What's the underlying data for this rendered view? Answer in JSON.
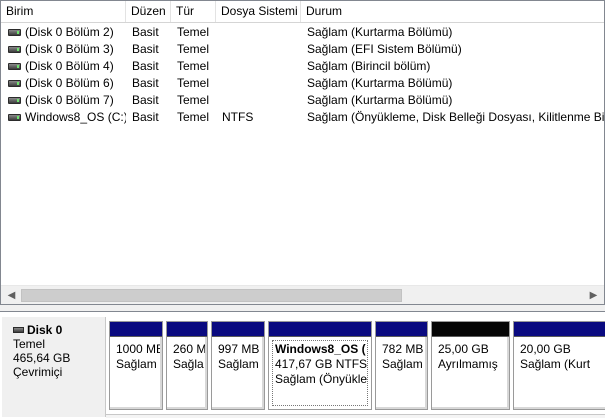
{
  "columns": [
    "Birim",
    "Düzen",
    "Tür",
    "Dosya Sistemi",
    "Durum"
  ],
  "volumes": [
    {
      "name": "(Disk 0 Bölüm 2)",
      "layout": "Basit",
      "type": "Temel",
      "fs": "",
      "status": "Sağlam (Kurtarma Bölümü)"
    },
    {
      "name": "(Disk 0 Bölüm 3)",
      "layout": "Basit",
      "type": "Temel",
      "fs": "",
      "status": "Sağlam (EFI Sistem Bölümü)"
    },
    {
      "name": "(Disk 0 Bölüm 4)",
      "layout": "Basit",
      "type": "Temel",
      "fs": "",
      "status": "Sağlam (Birincil bölüm)"
    },
    {
      "name": "(Disk 0 Bölüm 6)",
      "layout": "Basit",
      "type": "Temel",
      "fs": "",
      "status": "Sağlam (Kurtarma Bölümü)"
    },
    {
      "name": "(Disk 0 Bölüm 7)",
      "layout": "Basit",
      "type": "Temel",
      "fs": "",
      "status": "Sağlam (Kurtarma Bölümü)"
    },
    {
      "name": "Windows8_OS (C:)",
      "layout": "Basit",
      "type": "Temel",
      "fs": "NTFS",
      "status": "Sağlam (Önyükleme, Disk Belleği Dosyası, Kilitlenme Bil"
    }
  ],
  "scrollbar": {
    "left_arrow": "◀",
    "right_arrow": "▶"
  },
  "disk": {
    "name": "Disk 0",
    "type": "Temel",
    "size": "465,64 GB",
    "state": "Çevrimiçi"
  },
  "partitions": [
    {
      "name": "",
      "size": "1000 MB",
      "status": "Sağlam",
      "kind": "primary"
    },
    {
      "name": "",
      "size": "260 M",
      "status": "Sağla",
      "kind": "primary"
    },
    {
      "name": "",
      "size": "997 MB",
      "status": "Sağlam",
      "kind": "primary"
    },
    {
      "name": "Windows8_OS  (",
      "size": "417,67 GB NTFS",
      "status": "Sağlam (Önyükle",
      "kind": "primary"
    },
    {
      "name": "",
      "size": "782 MB",
      "status": "Sağlam",
      "kind": "primary"
    },
    {
      "name": "",
      "size": "25,00 GB",
      "status": "Ayrılmamış",
      "kind": "unallocated"
    },
    {
      "name": "",
      "size": "20,00 GB",
      "status": "Sağlam (Kurt",
      "kind": "primary"
    }
  ],
  "colors": {
    "primary_bar": "#0a0a80",
    "unallocated_bar": "#050505"
  }
}
